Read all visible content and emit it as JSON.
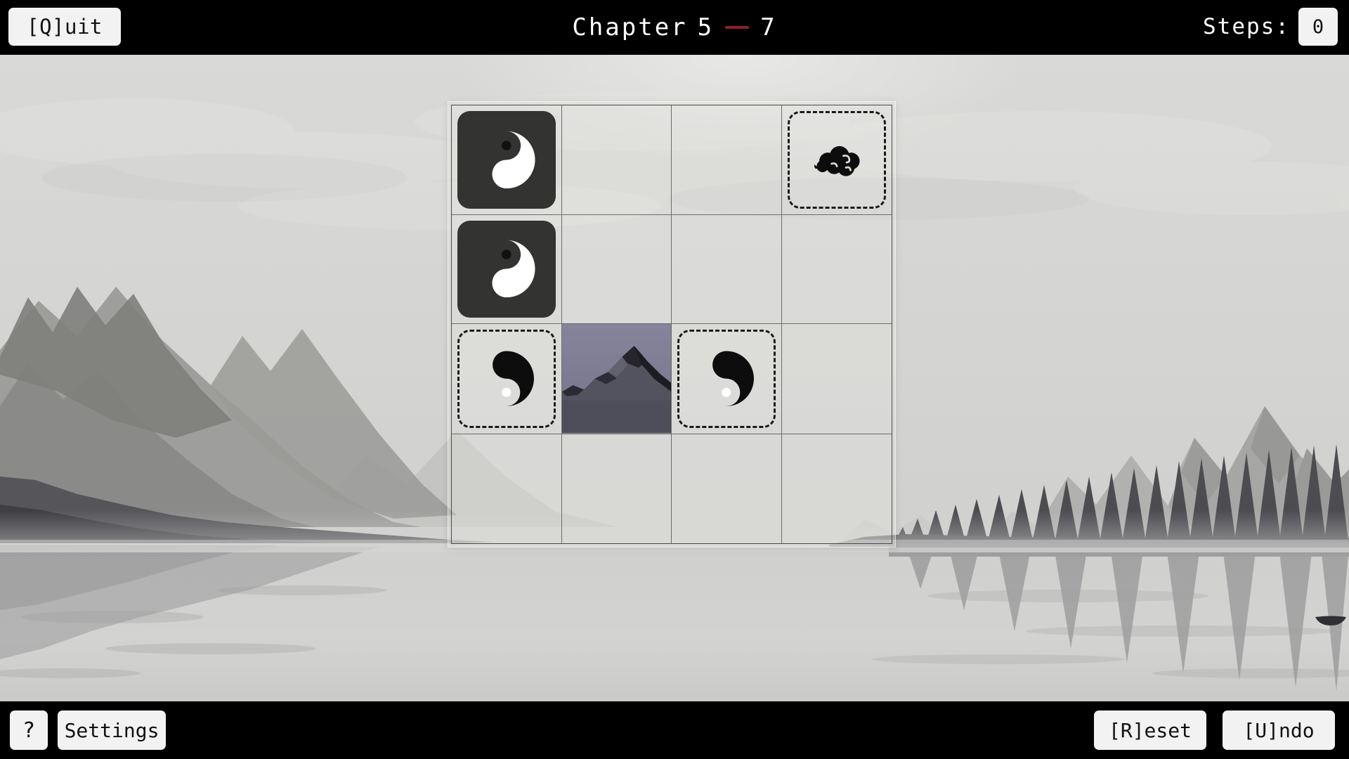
{
  "topbar": {
    "quit_label": "[Q]uit",
    "chapter_word": "Chapter",
    "chapter_number": "5",
    "level_number": "7",
    "separator_color": "#8e1f1f",
    "steps_label": "Steps:",
    "steps_value": "0"
  },
  "bottombar": {
    "help_label": "?",
    "settings_label": "Settings",
    "reset_label": "[R]eset",
    "undo_label": "[U]ndo"
  },
  "board": {
    "columns": 4,
    "rows": 4,
    "tile_dark_color": "#333332",
    "target_border_color": "#1a1a1a",
    "mountain_tile_sky_color": "#7b7a8c",
    "cells": [
      {
        "id": "r1c1",
        "kind": "tile-dark",
        "icon": "yinyang-white-icon",
        "label": "white yin-yang block"
      },
      {
        "id": "r1c2",
        "kind": "empty",
        "icon": "",
        "label": "empty cell"
      },
      {
        "id": "r1c3",
        "kind": "empty",
        "icon": "",
        "label": "empty cell"
      },
      {
        "id": "r1c4",
        "kind": "target",
        "icon": "cloud-icon",
        "label": "cloud goal cell"
      },
      {
        "id": "r2c1",
        "kind": "tile-dark",
        "icon": "yinyang-white-icon",
        "label": "white yin-yang block"
      },
      {
        "id": "r2c2",
        "kind": "empty",
        "icon": "",
        "label": "empty cell"
      },
      {
        "id": "r2c3",
        "kind": "empty",
        "icon": "",
        "label": "empty cell"
      },
      {
        "id": "r2c4",
        "kind": "empty",
        "icon": "",
        "label": "empty cell"
      },
      {
        "id": "r3c1",
        "kind": "target",
        "icon": "yinyang-black-icon",
        "label": "black yin-yang goal cell"
      },
      {
        "id": "r3c2",
        "kind": "mountain",
        "icon": "mountain-icon",
        "label": "mountain block"
      },
      {
        "id": "r3c3",
        "kind": "target",
        "icon": "yinyang-black-icon",
        "label": "black yin-yang goal cell"
      },
      {
        "id": "r3c4",
        "kind": "empty",
        "icon": "",
        "label": "empty cell"
      },
      {
        "id": "r4c1",
        "kind": "empty",
        "icon": "",
        "label": "empty cell"
      },
      {
        "id": "r4c2",
        "kind": "empty",
        "icon": "",
        "label": "empty cell"
      },
      {
        "id": "r4c3",
        "kind": "empty",
        "icon": "",
        "label": "empty cell"
      },
      {
        "id": "r4c4",
        "kind": "empty",
        "icon": "",
        "label": "empty cell"
      }
    ]
  },
  "scene": {
    "description": "misty ink-wash lake with mountains and reflections",
    "sky_color": "#d6d6d4",
    "water_color": "#cfcfcd"
  }
}
